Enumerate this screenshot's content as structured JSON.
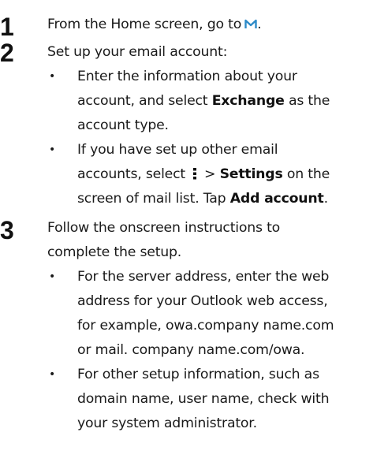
{
  "steps": [
    {
      "number": "1",
      "text_before": "From the Home screen, go to",
      "icon": "mail-icon",
      "text_after": "."
    },
    {
      "number": "2",
      "text": "Set up your email account:",
      "bullets": [
        {
          "lines": [
            "Enter the information about your",
            "account, and select "
          ],
          "bold": "Exchange",
          "tail": " as the",
          "line3": "account type."
        },
        {
          "line1": "If you have set up other email",
          "line2_prefix": "accounts, select",
          "icon": "menu-icon",
          "gt": ">",
          "bold1": "Settings",
          "line2_suffix": " on the",
          "line3_prefix": "screen of mail list. Tap ",
          "bold2": "Add account",
          "line3_suffix": "."
        }
      ]
    },
    {
      "number": "3",
      "lines": [
        "Follow the onscreen instructions to",
        "complete the setup."
      ],
      "bullets": [
        {
          "lines": [
            "For the server address, enter the web",
            "address for your Outlook web access,",
            "for example, owa.company name.com",
            "or mail. company name.com/owa."
          ]
        },
        {
          "lines": [
            "For other setup information, such as",
            "domain name, user name, check with",
            "your system administrator."
          ]
        }
      ]
    }
  ],
  "bullet_char": "•",
  "icon_color": "#2e8bc8"
}
